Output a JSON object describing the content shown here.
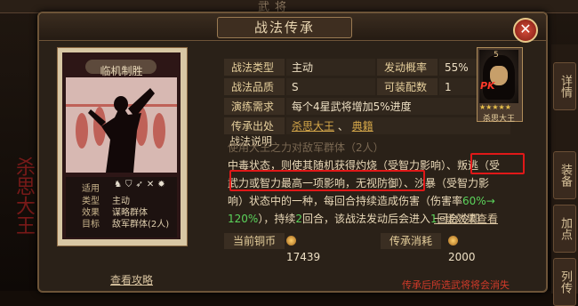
{
  "background": {
    "top_title": "武将",
    "left_title": "杀思大王",
    "right_tabs": [
      "详情",
      "装备",
      "加点",
      "列传"
    ]
  },
  "dialog": {
    "title": "战法传承",
    "close_label": "✕"
  },
  "skill_card": {
    "name": "临机制胜",
    "info": {
      "use_label": "适用",
      "type_label": "类型",
      "type_value": "主动",
      "effect_label": "效果",
      "effect_value": "谋略群体",
      "target_label": "目标",
      "target_value": "敌军群体(2人)"
    }
  },
  "attributes": {
    "type_label": "战法类型",
    "type_value": "主动",
    "rate_label": "发动概率",
    "rate_value": "55%",
    "quality_label": "战法品质",
    "quality_value": "S",
    "slots_label": "可装配数",
    "slots_value": "1",
    "learn_label": "演练需求",
    "learn_value": "每个4星武将增加5%进度",
    "source_label": "传承出处",
    "source_value_1": "杀思大王",
    "source_value_2": "典籍"
  },
  "general": {
    "level": "5",
    "pk_badge": "PK",
    "stars": "★★★★★",
    "name": "杀思大王"
  },
  "description": {
    "label": "战法说明",
    "line1_faded": "使用大王之力对敌军群体（2人）",
    "line2_a": "中毒状态，则使其随机获得灼烧（受智力影响）、",
    "line2_b": "叛逃（受",
    "line3_a": "武力或智力最高一项影响，无视防御）",
    "line3_b": "、沙暴（受智力影",
    "line4_a": "响）状态中的一种，每回合持续造成伤害（伤害率",
    "line4_green": "60%→",
    "line5_green": "120%",
    "line5_b": "），持续",
    "line5_c": "2",
    "line5_d": "回合，该战法发动后会进入",
    "line5_e": "1",
    "line5_f": "回合冷却",
    "more_link": "一级效果查看"
  },
  "costs": {
    "copper_label": "当前铜币",
    "copper_value": "17439",
    "inherit_label": "传承消耗",
    "inherit_value": "2000"
  },
  "footer": {
    "view_link": "查看攻略",
    "warning": "传承后所选武将将会消失"
  }
}
